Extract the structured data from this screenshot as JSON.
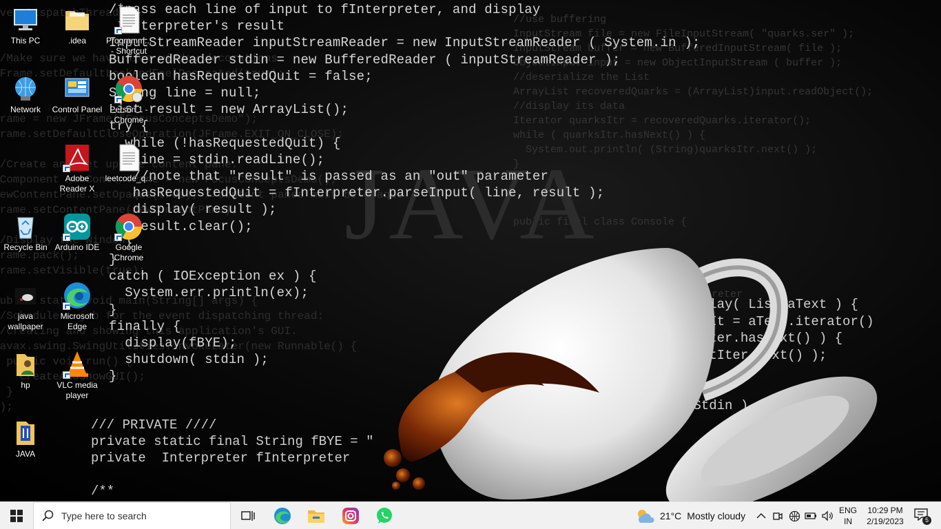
{
  "desktop": {
    "icons": [
      {
        "id": "this-pc",
        "label": "This PC"
      },
      {
        "id": "idea",
        "label": ".idea"
      },
      {
        "id": "programmer-shortcut",
        "label": "Programm...\n- Shortcut"
      },
      {
        "id": "network",
        "label": "Network"
      },
      {
        "id": "control-panel",
        "label": "Control Panel"
      },
      {
        "id": "person-chrome",
        "label": "Person 1 - Chrome"
      },
      {
        "id": "adobe",
        "label": "Adobe Reader X"
      },
      {
        "id": "leetcode",
        "label": "leetcode_q..."
      },
      {
        "id": "recycle",
        "label": "Recycle Bin"
      },
      {
        "id": "arduino",
        "label": "Arduino IDE"
      },
      {
        "id": "google-chrome",
        "label": "Google Chrome"
      },
      {
        "id": "java-wallpaper",
        "label": "java wallpaper"
      },
      {
        "id": "edge",
        "label": "Microsoft Edge"
      },
      {
        "id": "hp",
        "label": "hp"
      },
      {
        "id": "vlc",
        "label": "VLC media player"
      },
      {
        "id": "java",
        "label": "JAVA"
      }
    ]
  },
  "wallpaper": {
    "word": "JAVA",
    "code_main": "/*pass each line of input to fInterpreter, and display\n *Interpreter's result\nInputStreamReader inputStreamReader = new InputStreamReader ( System.in );\nBufferedReader stdin = new BufferedReader ( inputStreamReader );\nboolean hasRequestedQuit = false;\nString line = null;\nList result = new ArrayList();\ntry {\n  while (!hasRequestedQuit) {\n   line = stdin.readLine();\n   //note that \"result\" is passed as an \"out\" parameter\n   hasRequestedQuit = fInterpreter.parseInput( line, result );\n   display( result );\n   result.clear();\n  }\n}\ncatch ( IOException ex ) {\n  System.err.println(ex);\n}\nfinally {\n  display(fBYE);\n  shutdown( stdin );\n}",
    "code_private": "/// PRIVATE ////\nprivate static final String fBYE = \"\nprivate  Interpreter fInterpreter\n\n/**",
    "code_right": "isplay( List aText ) {\nextIt = aText.iterator()\nxtIter.hasNext() ) {\ntextIter.next() );\n\n\naStdin )",
    "code_bg_left": "eventDispatchThread\n\n\n//Make sure we have nice window decorations.\nJFrame.setDefaultLookAndFeelDecorated(true);\n\n\nframe = new JFrame(\"FocusConceptsDemo\");\nframe.setDefaultCloseOperation(JFrame.EXIT_ON_CLOSE);\n\n//Create and set up the content pane.\nJComponent newContentPane = new FocusConceptsDemo();\nnewContentPane.setOpaque(true); //content panes must be opaque\nframe.setContentPane(newContentPane);\n\n//Display the window.\nframe.pack();\nframe.setVisible(true);\n\npublic static void main(String[] args) {\n//Schedule a job for the event dispatching thread:\n//creating and showing this application's GUI.\njavax.swing.SwingUtilities.invokeLater(new Runnable() {\n  public void run() {\n    createAndShowGUI();\n  }\n});",
    "code_bg_right": "//use buffering\nInputStream file = new FileInputStream( \"quarks.ser\" );\nInputStream buffer = new BufferedInputStream( file );\nObjectInput input = new ObjectInputStream ( buffer );\n//deserialize the List\nArrayList recoveredQuarks = (ArrayList)input.readObject();\n//display its data\nIterator quarksItr = recoveredQuarks.iterator();\nwhile ( quarksItr.hasNext() ) {\n  System.out.println( (String)quarksItr.next() );\n}\n\n\n\npublic final class Console {\n\n\n\n\n * Build a specific <code>Interpreter\n * ...is passed in on the c"
  },
  "taskbar": {
    "search_placeholder": "Type here to search",
    "weather_temp": "21°C",
    "weather_text": "Mostly cloudy",
    "lang_top": "ENG",
    "lang_bottom": "IN",
    "time": "10:29 PM",
    "date": "2/19/2023",
    "notification_count": "5"
  }
}
